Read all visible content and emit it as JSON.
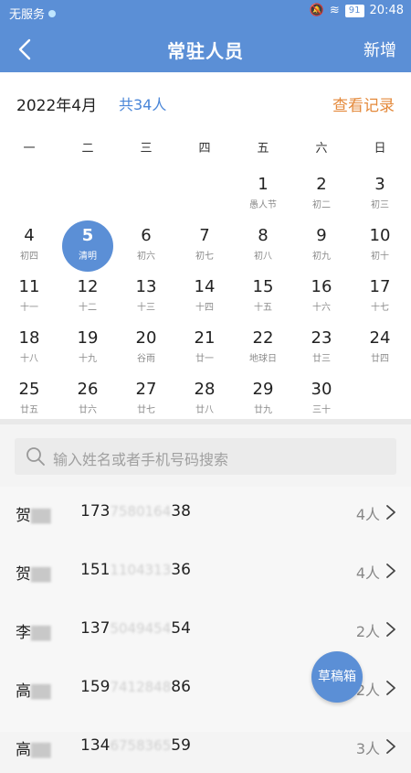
{
  "status_bar": {
    "carrier": "无服务",
    "battery": "91",
    "time": "20:48"
  },
  "navbar": {
    "title": "常驻人员",
    "add_label": "新增"
  },
  "calendar": {
    "month_label": "2022年4月",
    "total_label": "共34人",
    "records_label": "查看记录",
    "weekdays": [
      "一",
      "二",
      "三",
      "四",
      "五",
      "六",
      "日"
    ],
    "selected_day": "5",
    "days": [
      {
        "d": "1",
        "l": "愚人节"
      },
      {
        "d": "2",
        "l": "初二"
      },
      {
        "d": "3",
        "l": "初三"
      },
      {
        "d": "4",
        "l": "初四"
      },
      {
        "d": "5",
        "l": "清明"
      },
      {
        "d": "6",
        "l": "初六"
      },
      {
        "d": "7",
        "l": "初七"
      },
      {
        "d": "8",
        "l": "初八"
      },
      {
        "d": "9",
        "l": "初九"
      },
      {
        "d": "10",
        "l": "初十"
      },
      {
        "d": "11",
        "l": "十一"
      },
      {
        "d": "12",
        "l": "十二"
      },
      {
        "d": "13",
        "l": "十三"
      },
      {
        "d": "14",
        "l": "十四"
      },
      {
        "d": "15",
        "l": "十五"
      },
      {
        "d": "16",
        "l": "十六"
      },
      {
        "d": "17",
        "l": "十七"
      },
      {
        "d": "18",
        "l": "十八"
      },
      {
        "d": "19",
        "l": "十九"
      },
      {
        "d": "20",
        "l": "谷雨"
      },
      {
        "d": "21",
        "l": "廿一"
      },
      {
        "d": "22",
        "l": "地球日"
      },
      {
        "d": "23",
        "l": "廿三"
      },
      {
        "d": "24",
        "l": "廿四"
      },
      {
        "d": "25",
        "l": "廿五"
      },
      {
        "d": "26",
        "l": "廿六"
      },
      {
        "d": "27",
        "l": "廿七"
      },
      {
        "d": "28",
        "l": "廿八"
      },
      {
        "d": "29",
        "l": "廿九"
      },
      {
        "d": "30",
        "l": "三十"
      }
    ]
  },
  "search": {
    "placeholder": "输入姓名或者手机号码搜索"
  },
  "people": [
    {
      "surname": "贺",
      "hidden_name": "██",
      "phone_start": "173",
      "phone_hidden": "7580164",
      "phone_end": "38",
      "count": "4人"
    },
    {
      "surname": "贺",
      "hidden_name": "██",
      "phone_start": "151",
      "phone_hidden": "1104313",
      "phone_end": "36",
      "count": "4人"
    },
    {
      "surname": "李",
      "hidden_name": "██",
      "phone_start": "137",
      "phone_hidden": "5049454",
      "phone_end": "54",
      "count": "2人"
    },
    {
      "surname": "高",
      "hidden_name": "██",
      "phone_start": "159",
      "phone_hidden": "7412848",
      "phone_end": "86",
      "count": "2人"
    },
    {
      "surname": "高",
      "hidden_name": "██",
      "phone_start": "134",
      "phone_hidden": "6758365",
      "phone_end": "59",
      "count": "3人"
    }
  ],
  "fab_label": "草稿箱"
}
